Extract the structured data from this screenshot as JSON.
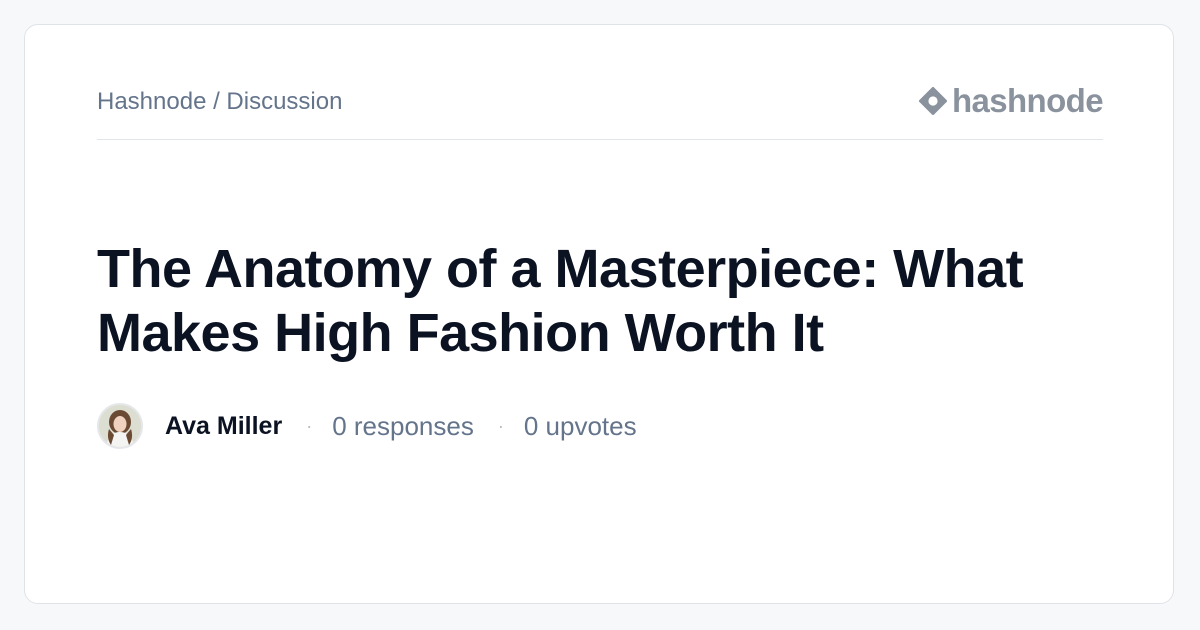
{
  "breadcrumb": "Hashnode / Discussion",
  "brand": {
    "name": "hashnode",
    "icon": "hashnode-logo-icon",
    "color": "#8a929e"
  },
  "title": "The Anatomy of a Masterpiece: What Makes High Fashion Worth It",
  "author": {
    "name": "Ava Miller",
    "avatar": "author-avatar"
  },
  "stats": {
    "responses": "0 responses",
    "upvotes": "0 upvotes"
  },
  "separator": "·",
  "colors": {
    "background": "#f7f8fa",
    "card": "#ffffff",
    "title_text": "#0b1222",
    "muted_text": "#64748b"
  }
}
